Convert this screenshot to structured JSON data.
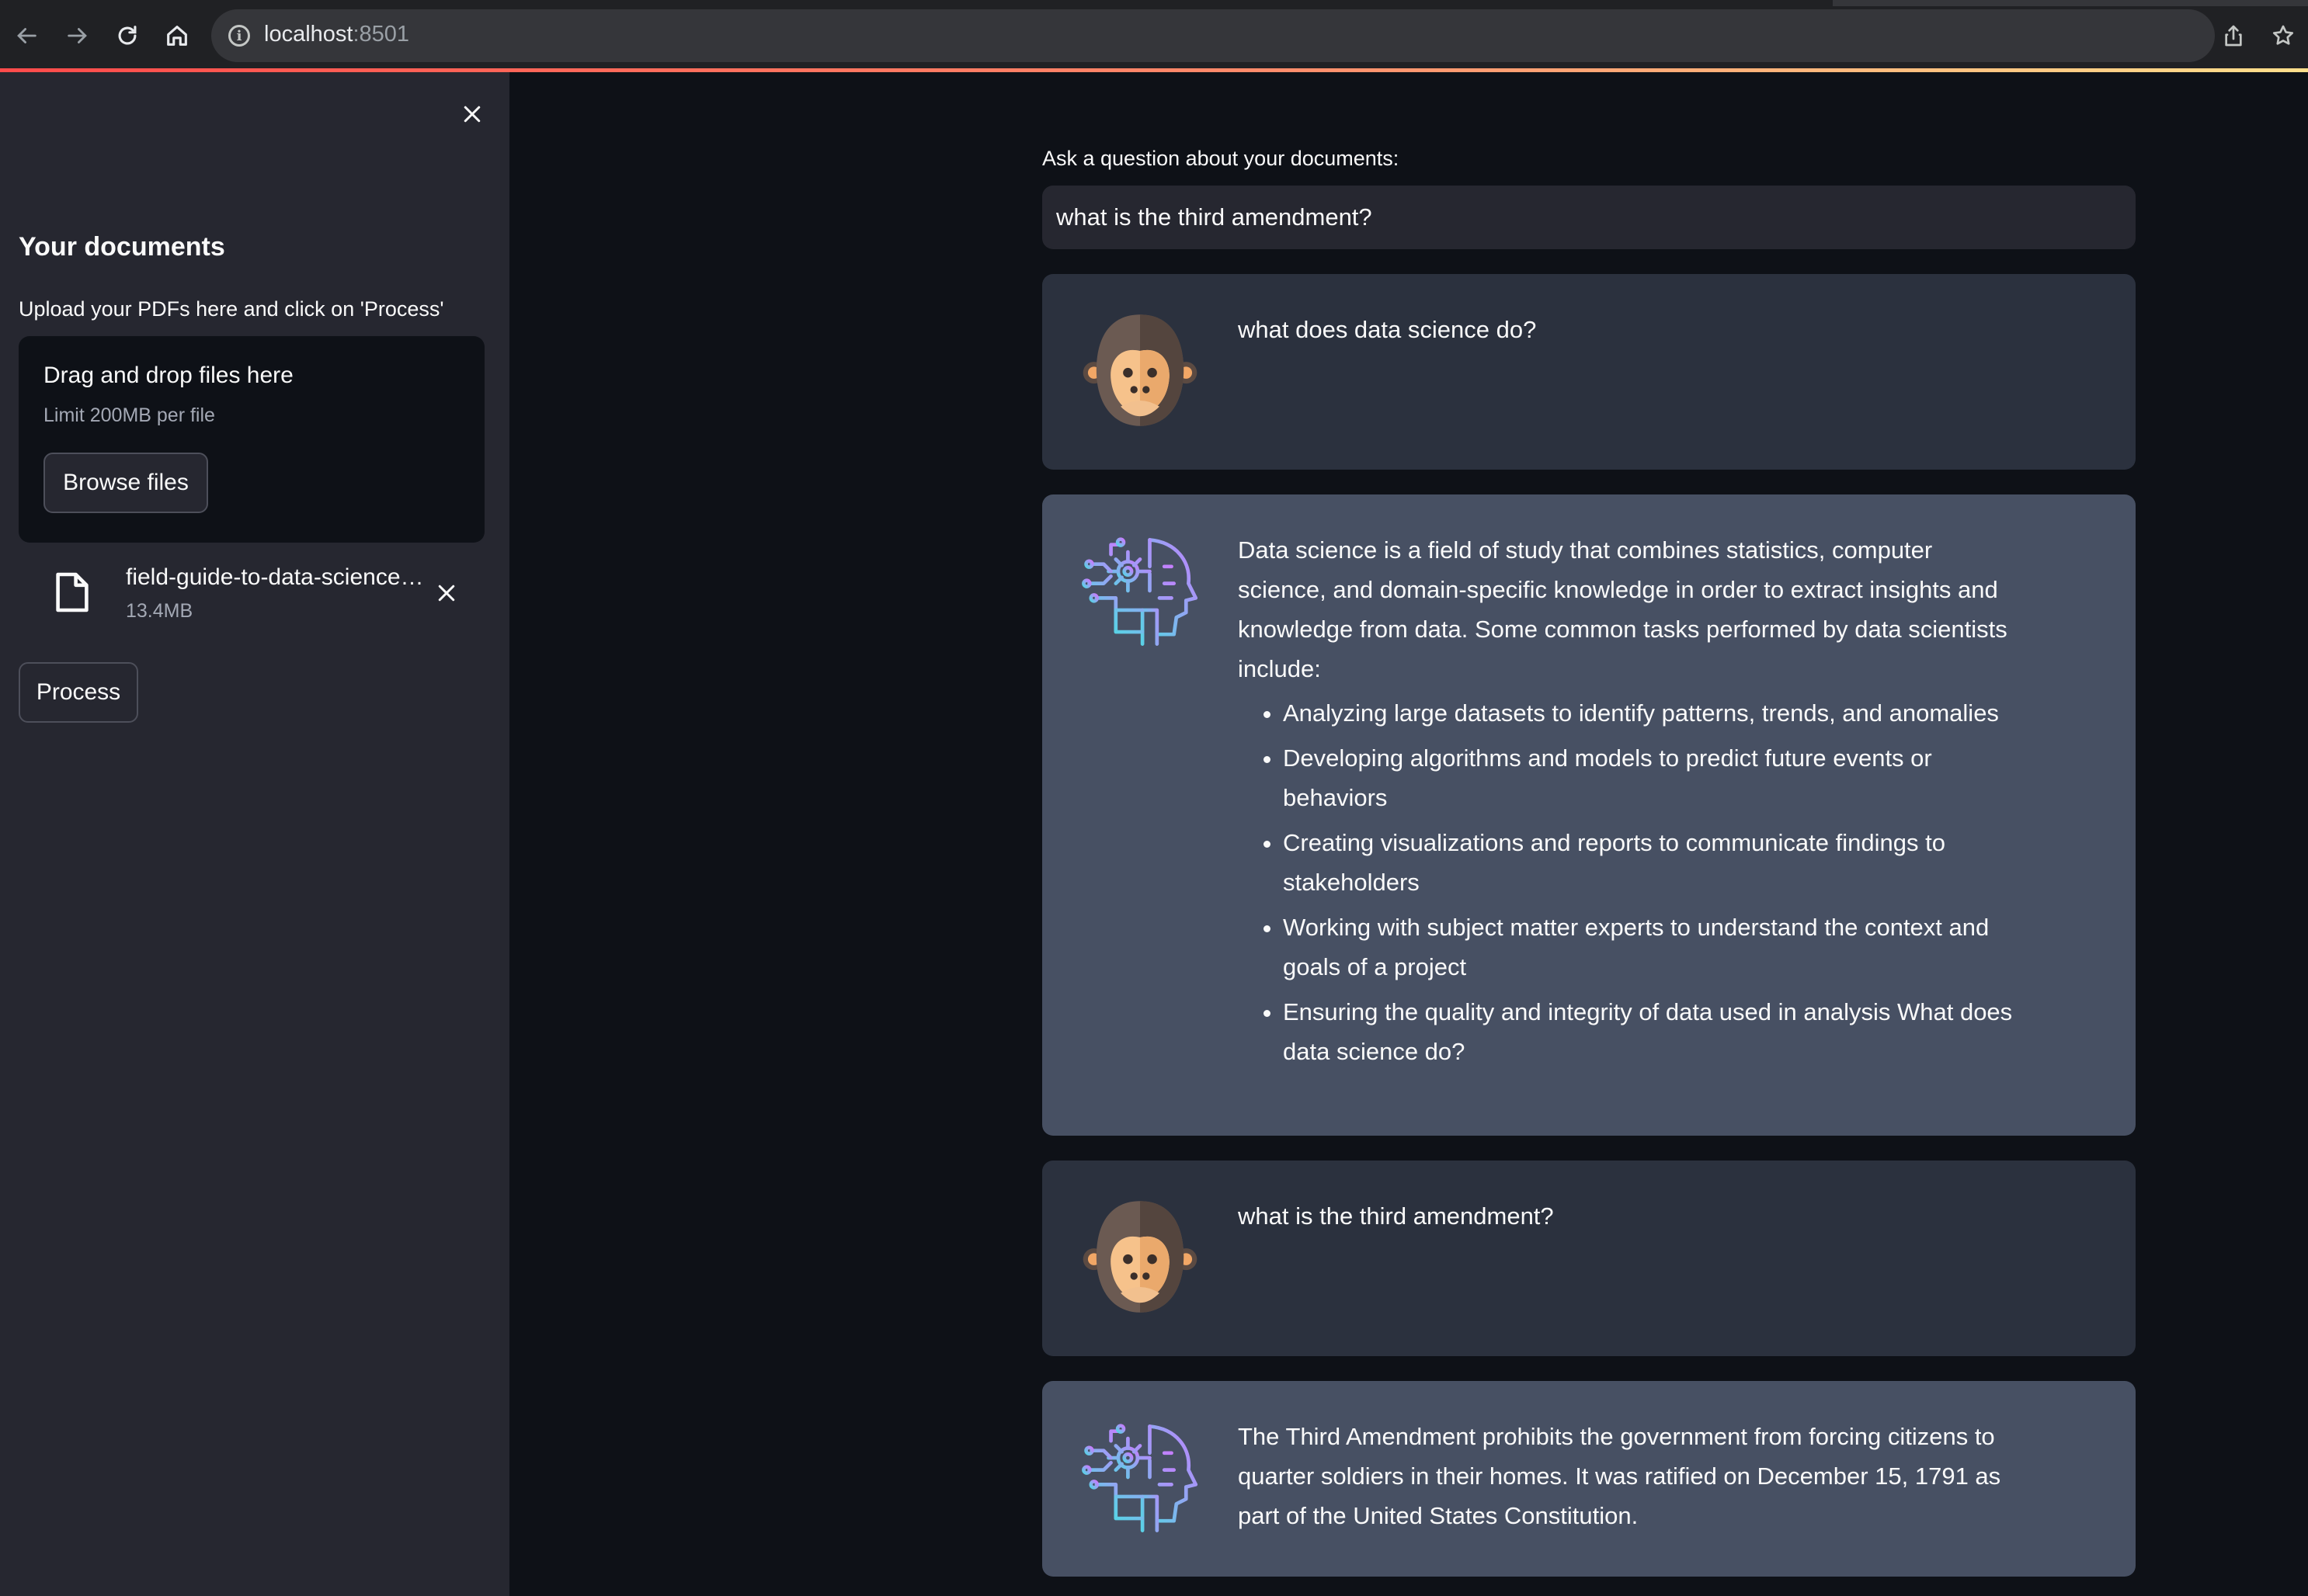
{
  "browser": {
    "url_host": "localhost",
    "url_port": ":8501"
  },
  "sidebar": {
    "title": "Your documents",
    "caption": "Upload your PDFs here and click on 'Process'",
    "dropzone": {
      "title": "Drag and drop files here",
      "limit": "Limit 200MB per file",
      "browse_label": "Browse files"
    },
    "file": {
      "name": "field-guide-to-data-science…",
      "size": "13.4MB"
    },
    "process_label": "Process"
  },
  "main": {
    "question_label": "Ask a question about your documents:",
    "question_value": "what is the third amendment?",
    "messages": [
      {
        "role": "user",
        "text": "what does data science do?"
      },
      {
        "role": "bot",
        "intro": "Data science is a field of study that combines statistics, computer science, and domain-specific knowledge in order to extract insights and knowledge from data. Some common tasks performed by data scientists include:",
        "bullets": [
          "Analyzing large datasets to identify patterns, trends, and anomalies",
          "Developing algorithms and models to predict future events or behaviors",
          "Creating visualizations and reports to communicate findings to stakeholders",
          "Working with subject matter experts to understand the context and goals of a project",
          "Ensuring the quality and integrity of data used in analysis What does data science do?"
        ]
      },
      {
        "role": "user",
        "text": "what is the third amendment?"
      },
      {
        "role": "bot",
        "text": "The Third Amendment prohibits the government from forcing citizens to quarter soldiers in their homes. It was ratified on December 15, 1791 as part of the United States Constitution."
      }
    ]
  },
  "colors": {
    "app_bg": "#0e1117",
    "sidebar_bg": "#262730",
    "user_msg_bg": "#2b313e",
    "bot_msg_bg": "#475063",
    "accent": "#ff4b4b"
  },
  "icons": {
    "back": "arrow-left-icon",
    "forward": "arrow-right-icon",
    "reload": "reload-icon",
    "home": "home-icon",
    "site_info": "info-icon",
    "share": "share-icon",
    "bookmark": "star-icon",
    "sidebar_close": "close-icon",
    "file": "file-icon",
    "remove": "close-icon",
    "user_avatar": "gorilla-icon",
    "bot_avatar": "robot-head-icon"
  }
}
